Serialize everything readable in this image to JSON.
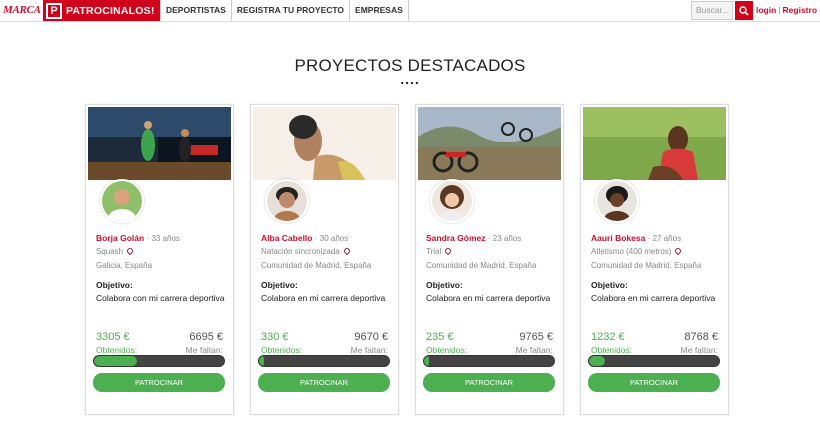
{
  "nav": {
    "brand": "MARCA",
    "product_mark": "P",
    "product": "PATROCINALOS!",
    "links": [
      "DEPORTISTAS",
      "REGISTRA TU PROYECTO",
      "EMPRESAS"
    ],
    "search_placeholder": "Buscar...",
    "login": "login",
    "separator": "|",
    "register": "Registro"
  },
  "section": {
    "title": "PROYECTOS DESTACADOS",
    "dots": "...."
  },
  "colors": {
    "accent": "#d0021b",
    "progress": "#4caf50"
  },
  "cards": [
    {
      "name": "Borja Golán",
      "age": "· 33 años",
      "sport": "Squash",
      "location": "Galicia, España",
      "objective_label": "Objetivo:",
      "objective": "Colabora con mi carrera deportiva",
      "raised": "3305 €",
      "raised_label": "Obtenidos:",
      "missing": "6695 €",
      "missing_label": "Me faltan:",
      "progress": 0.33,
      "button": "PATROCINAR"
    },
    {
      "name": "Alba Cabello",
      "age": "· 30 años",
      "sport": "Natación sincronizada",
      "location": "Comunidad de Madrid, España",
      "objective_label": "Objetivo:",
      "objective": "Colabora en mi carrera deportiva",
      "raised": "330 €",
      "raised_label": "Obtenidos:",
      "missing": "9670 €",
      "missing_label": "Me faltan:",
      "progress": 0.033,
      "button": "PATROCINAR"
    },
    {
      "name": "Sandra Gómez",
      "age": "· 23 años",
      "sport": "Trial",
      "location": "Comunidad de Madrid, España",
      "objective_label": "Objetivo:",
      "objective": "Colabora en mi carrera deportiva",
      "raised": "235 €",
      "raised_label": "Obtenidos:",
      "missing": "9765 €",
      "missing_label": "Me faltan:",
      "progress": 0.0235,
      "button": "PATROCINAR"
    },
    {
      "name": "Aauri Bokesa",
      "age": "· 27 años",
      "sport": "Atletismo (400 metros)",
      "location": "Comunidad de Madrid, España",
      "objective_label": "Objetivo:",
      "objective": "Colabora en mi carrera deportiva",
      "raised": "1232 €",
      "raised_label": "Obtenidos:",
      "missing": "8768 €",
      "missing_label": "Me faltan:",
      "progress": 0.123,
      "button": "PATROCINAR"
    }
  ]
}
